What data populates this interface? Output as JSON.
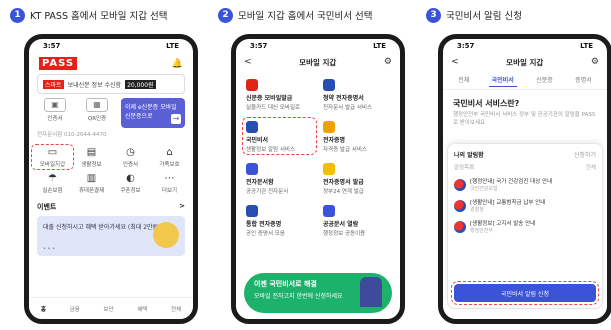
{
  "steps": [
    {
      "num": "1",
      "text": "KT PASS 홈에서 모바일 지갑 선택"
    },
    {
      "num": "2",
      "text": "모바일 지갑 홈에서 국민비서 선택"
    },
    {
      "num": "3",
      "text": "국민비서 알림 신청"
    }
  ],
  "phone1": {
    "time": "3:57",
    "signal": "LTE",
    "logo": "PASS",
    "card": {
      "badge": "스마트",
      "text": "보내신분 정보 수신함",
      "amount": "20,000원"
    },
    "quick": [
      {
        "label": "인증서"
      },
      {
        "label": "QR인증"
      }
    ],
    "banner": {
      "text": "이제 e신분증 모바일 신분증으로",
      "arrow": "→"
    },
    "note": "전자문서함 010-2644-4470",
    "menu": [
      {
        "label": "모바일지갑",
        "icon": "▭"
      },
      {
        "label": "생활정보",
        "icon": "▤"
      },
      {
        "label": "인증서",
        "icon": "◷"
      },
      {
        "label": "가족보호",
        "icon": "⌂"
      },
      {
        "label": "실손보험",
        "icon": "☂"
      },
      {
        "label": "휴대폰결제",
        "icon": "▥"
      },
      {
        "label": "쿠폰정보",
        "icon": "◐"
      },
      {
        "label": "더보기",
        "icon": "⋯"
      }
    ],
    "section_title": "이벤트",
    "section_more": ">",
    "ad_text": "대출 신청하시고 혜택 받아가세요 (최대 2만원 지급)",
    "ad_dots": "• • •",
    "nav": [
      "홈",
      "금융",
      "보안",
      "혜택",
      "전체"
    ]
  },
  "phone2": {
    "time": "3:57",
    "signal": "LTE",
    "title": "모바일 지갑",
    "back": "<",
    "services": [
      {
        "name": "신분증 모바일발급",
        "desc": "실물카드 대신 모바일로",
        "color": "#e2231a"
      },
      {
        "name": "청약 전자증명서",
        "desc": "전자문서 발급 서비스",
        "color": "#2a4db4"
      },
      {
        "name": "국민비서",
        "desc": "생활정보 알림 서비스",
        "color": "#2a4db4"
      },
      {
        "name": "전자증명",
        "desc": "자격증 발급 서비스",
        "color": "#f0a000"
      },
      {
        "name": "전자문서함",
        "desc": "공공기관 전자문서",
        "color": "#3b53d6"
      },
      {
        "name": "전자증명서 발급",
        "desc": "정부24 연계 발급",
        "color": "#f0c000"
      },
      {
        "name": "통합 전자증명",
        "desc": "공인 증명서 모음",
        "color": "#2a4db4"
      },
      {
        "name": "공공문서 열람",
        "desc": "행정정보 공동이용",
        "color": "#3b53d6"
      }
    ],
    "promo_title": "이젠 국민비서로 해결",
    "promo_text": "모바일 전자고지 한번에 신청하세요"
  },
  "phone3": {
    "time": "3:57",
    "signal": "LTE",
    "title": "모바일 지갑",
    "back": "<",
    "tabs": [
      "전체",
      "국민비서",
      "신분증",
      "증명서"
    ],
    "heading": "국민비서 서비스란?",
    "desc": "행정안전부 국민비서 서비스 정부 및 공공기관의 알림을 PASS로 받아보세요",
    "sheet_title": "나의 알림함",
    "sheet_more": "신청하기",
    "sheet_sub_left": "알림목록",
    "sheet_sub_right": "전체",
    "docs": [
      {
        "title": "[행정안내] 국가 건강검진 대상 안내",
        "org": "국민건강보험"
      },
      {
        "title": "[생활안내] 교통범칙금 납부 안내",
        "org": "경찰청"
      },
      {
        "title": "[생활정보] 고지서 발송 안내",
        "org": "행정안전부"
      }
    ],
    "cta": "국민비서 알림 신청"
  }
}
